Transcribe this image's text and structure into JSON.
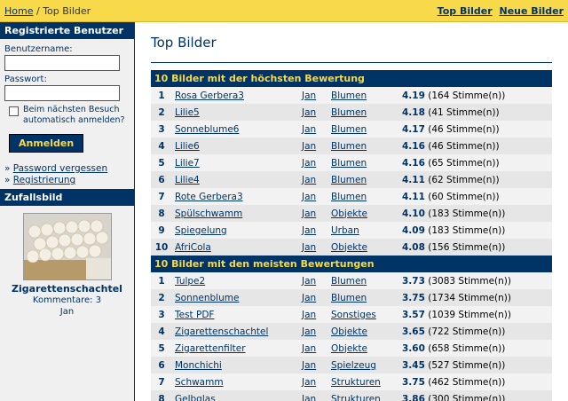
{
  "topbar": {
    "home": "Home",
    "separator": "/",
    "current": "Top Bilder",
    "links": [
      "Top Bilder",
      "Neue Bilder"
    ]
  },
  "sidebar": {
    "login_title": "Registrierte Benutzer",
    "username_label": "Benutzername:",
    "password_label": "Passwort:",
    "autologin_label": "Beim nächsten Besuch automatisch anmelden?",
    "login_button": "Anmelden",
    "forgot_password": "Password vergessen",
    "register": "Registrierung",
    "random_title": "Zufallsbild",
    "random_name": "Zigarettenschachtel",
    "random_comments": "Kommentare: 3",
    "random_user": "Jan"
  },
  "main": {
    "title": "Top Bilder",
    "section1_title": "10 Bilder mit der höchsten Bewertung",
    "section1_rows": [
      {
        "num": "1",
        "title": "Rosa Gerbera3",
        "user": "Jan",
        "cat": "Blumen",
        "rating": "4.19",
        "votes": "(164 Stimme(n))"
      },
      {
        "num": "2",
        "title": "Lilie5",
        "user": "Jan",
        "cat": "Blumen",
        "rating": "4.18",
        "votes": "(41 Stimme(n))"
      },
      {
        "num": "3",
        "title": "Sonneblume6",
        "user": "Jan",
        "cat": "Blumen",
        "rating": "4.17",
        "votes": "(46 Stimme(n))"
      },
      {
        "num": "4",
        "title": "Lilie6",
        "user": "Jan",
        "cat": "Blumen",
        "rating": "4.16",
        "votes": "(46 Stimme(n))"
      },
      {
        "num": "5",
        "title": "Lilie7",
        "user": "Jan",
        "cat": "Blumen",
        "rating": "4.16",
        "votes": "(65 Stimme(n))"
      },
      {
        "num": "6",
        "title": "Lilie4",
        "user": "Jan",
        "cat": "Blumen",
        "rating": "4.11",
        "votes": "(62 Stimme(n))"
      },
      {
        "num": "7",
        "title": "Rote Gerbera3",
        "user": "Jan",
        "cat": "Blumen",
        "rating": "4.11",
        "votes": "(60 Stimme(n))"
      },
      {
        "num": "8",
        "title": "Spülschwamm",
        "user": "Jan",
        "cat": "Objekte",
        "rating": "4.10",
        "votes": "(183 Stimme(n))"
      },
      {
        "num": "9",
        "title": "Spiegelung",
        "user": "Jan",
        "cat": "Urban",
        "rating": "4.09",
        "votes": "(183 Stimme(n))"
      },
      {
        "num": "10",
        "title": "AfriCola",
        "user": "Jan",
        "cat": "Objekte",
        "rating": "4.08",
        "votes": "(156 Stimme(n))"
      }
    ],
    "section2_title": "10 Bilder mit den meisten Bewertungen",
    "section2_rows": [
      {
        "num": "1",
        "title": "Tulpe2",
        "user": "Jan",
        "cat": "Blumen",
        "rating": "3.73",
        "votes": "(3083 Stimme(n))"
      },
      {
        "num": "2",
        "title": "Sonnenblume",
        "user": "Jan",
        "cat": "Blumen",
        "rating": "3.75",
        "votes": "(1734 Stimme(n))"
      },
      {
        "num": "3",
        "title": "Test PDF",
        "user": "Jan",
        "cat": "Sonstiges",
        "rating": "3.57",
        "votes": "(1039 Stimme(n))"
      },
      {
        "num": "4",
        "title": "Zigarettenschachtel",
        "user": "Jan",
        "cat": "Objekte",
        "rating": "3.65",
        "votes": "(722 Stimme(n))"
      },
      {
        "num": "5",
        "title": "Zigarettenfilter",
        "user": "Jan",
        "cat": "Objekte",
        "rating": "3.60",
        "votes": "(658 Stimme(n))"
      },
      {
        "num": "6",
        "title": "Monchichi",
        "user": "Jan",
        "cat": "Spielzeug",
        "rating": "3.45",
        "votes": "(527 Stimme(n))"
      },
      {
        "num": "7",
        "title": "Schwamm",
        "user": "Jan",
        "cat": "Strukturen",
        "rating": "3.75",
        "votes": "(462 Stimme(n))"
      },
      {
        "num": "8",
        "title": "Gelbglas",
        "user": "Jan",
        "cat": "Strukturen",
        "rating": "3.86",
        "votes": "(300 Stimme(n))"
      }
    ]
  },
  "colors": {
    "accent_blue": "#003366",
    "accent_yellow": "#f8d94a"
  }
}
